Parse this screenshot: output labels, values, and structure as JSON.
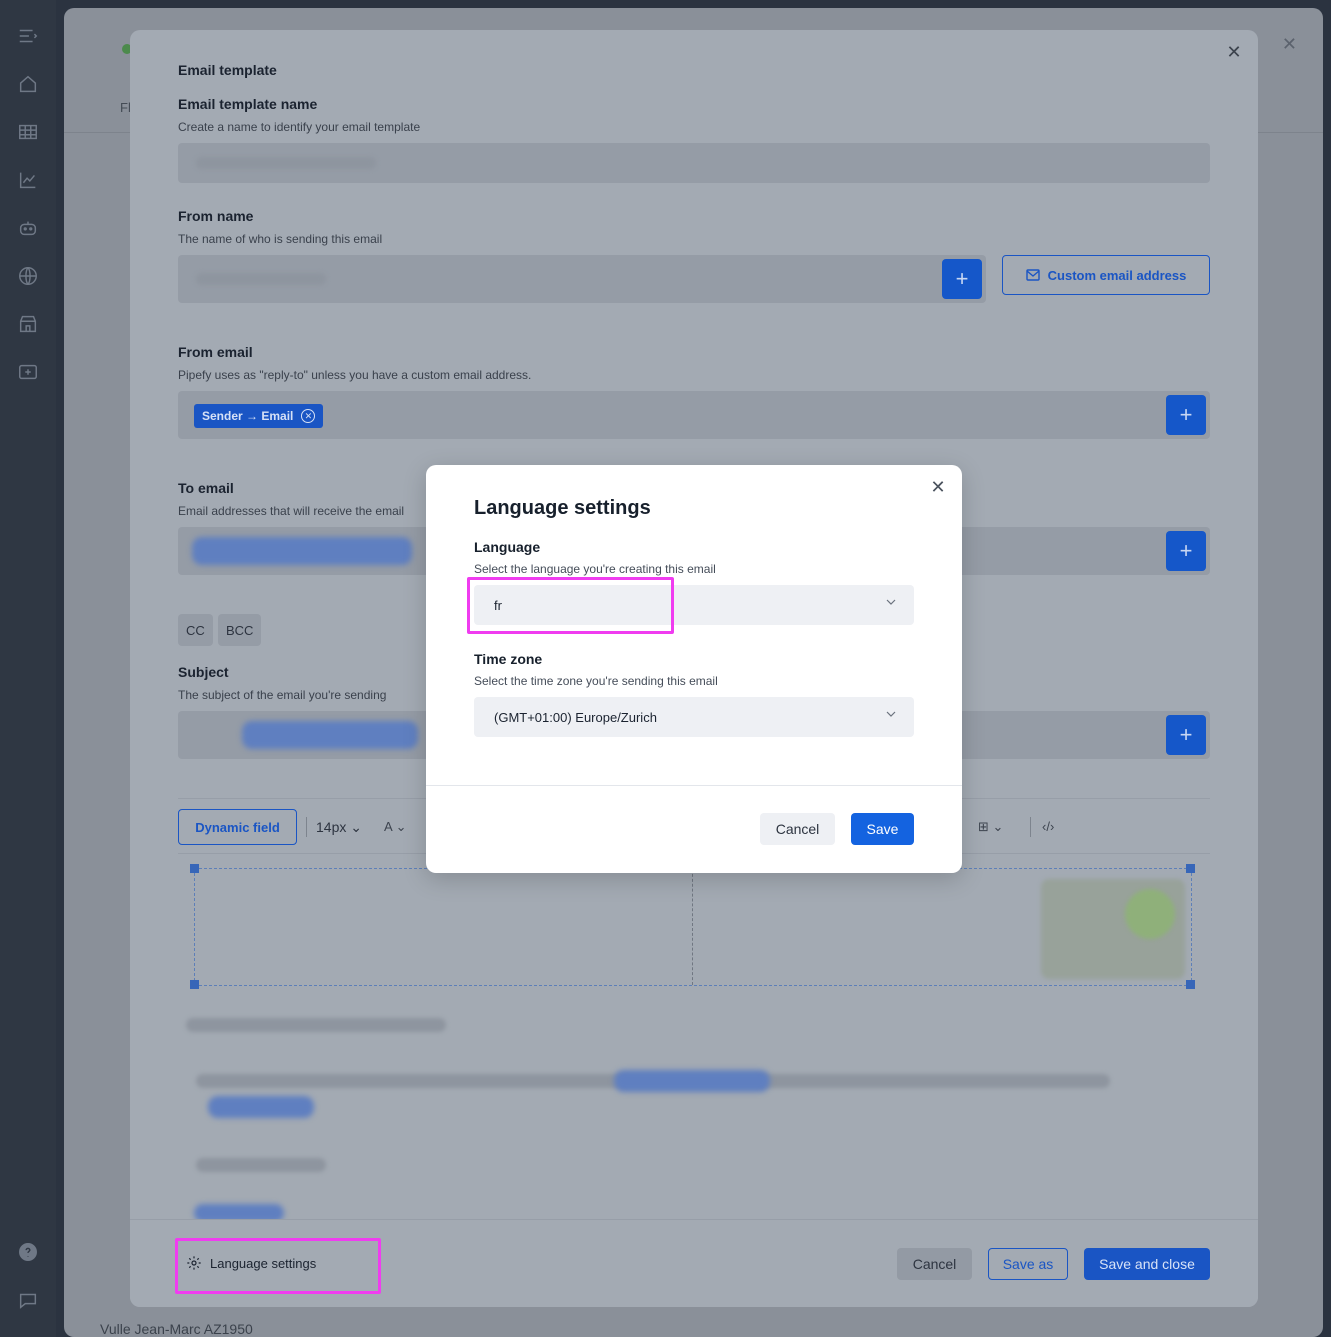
{
  "background": {
    "tab_fragment": "Fl",
    "footer_fragment": "Vulle Jean-Marc AZ1950"
  },
  "email_template": {
    "title": "Email template",
    "template_name": {
      "label": "Email template name",
      "help": "Create a name to identify your email template"
    },
    "from_name": {
      "label": "From name",
      "help": "The name of who is sending this email"
    },
    "custom_email_button": "Custom email address",
    "from_email": {
      "label": "From email",
      "help": "Pipefy uses as \"reply-to\" unless you have a custom email address.",
      "chip": "Sender → Email"
    },
    "to_email": {
      "label": "To email",
      "help": "Email addresses that will receive the email"
    },
    "cc_label": "CC",
    "bcc_label": "BCC",
    "subject": {
      "label": "Subject",
      "help": "The subject of the email you're sending"
    },
    "toolbar": {
      "dynamic_field": "Dynamic field",
      "font_size": "14px"
    },
    "footer": {
      "language_settings": "Language settings",
      "cancel": "Cancel",
      "save_as": "Save as",
      "save_and_close": "Save and close"
    }
  },
  "language_dialog": {
    "title": "Language settings",
    "language": {
      "label": "Language",
      "help": "Select the language you're creating this email",
      "value": "fr"
    },
    "timezone": {
      "label": "Time zone",
      "help": "Select the time zone you're sending this email",
      "value": "(GMT+01:00) Europe/Zurich"
    },
    "cancel": "Cancel",
    "save": "Save"
  },
  "colors": {
    "primary": "#1463e0",
    "highlight": "#f03cf0"
  },
  "icons": [
    "menu-icon",
    "home-icon",
    "table-icon",
    "chart-icon",
    "bot-icon",
    "globe-icon",
    "store-icon",
    "add-box-icon",
    "help-icon",
    "chat-icon",
    "close-icon",
    "plus-icon",
    "mail-icon",
    "gear-icon",
    "chevron-down-icon"
  ]
}
